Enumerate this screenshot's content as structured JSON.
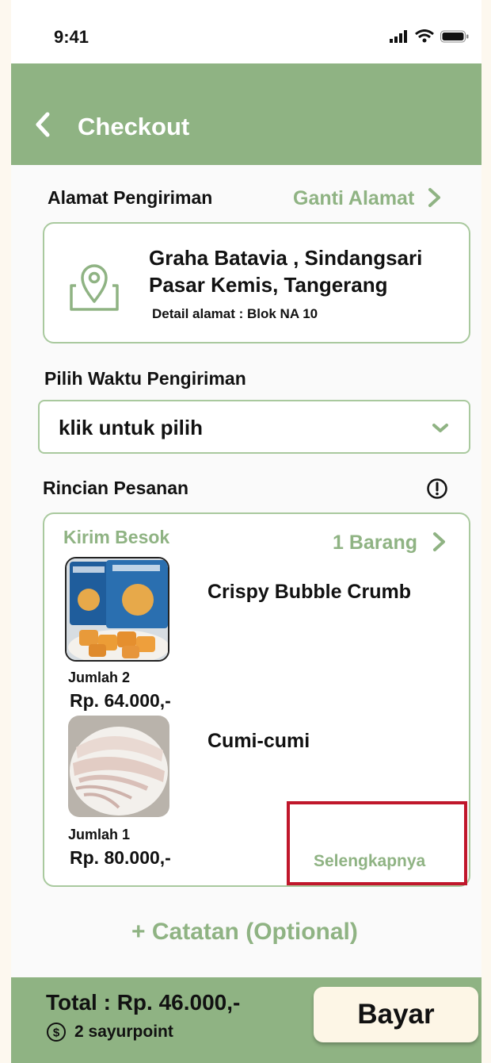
{
  "status_bar": {
    "time": "9:41"
  },
  "header": {
    "title": "Checkout"
  },
  "address_section": {
    "label": "Alamat Pengiriman",
    "change_link": "Ganti Alamat",
    "line1": "Graha Batavia , Sindangsari",
    "line2": "Pasar Kemis, Tangerang",
    "detail": "Detail alamat :  Blok NA 10"
  },
  "delivery_time": {
    "label": "Pilih Waktu Pengiriman",
    "dropdown_value": "klik untuk pilih"
  },
  "order": {
    "label": "Rincian Pesanan",
    "delivery_tag": "Kirim  Besok",
    "item_count": "1 Barang",
    "more_link": "Selengkapnya",
    "items": [
      {
        "name": "Crispy Bubble Crumb",
        "quantity": "Jumlah 2",
        "price": "Rp. 64.000,-"
      },
      {
        "name": "Cumi-cumi",
        "quantity": "Jumlah 1",
        "price": "Rp. 80.000,-"
      }
    ]
  },
  "notes_link": "+ Catatan (Optional)",
  "footer": {
    "total": "Total : Rp. 46.000,-",
    "points": "2 sayurpoint",
    "pay_button": "Bayar"
  },
  "colors": {
    "accent": "#8fb383",
    "highlight": "#c0172b",
    "button_bg": "#fdf6e6"
  }
}
